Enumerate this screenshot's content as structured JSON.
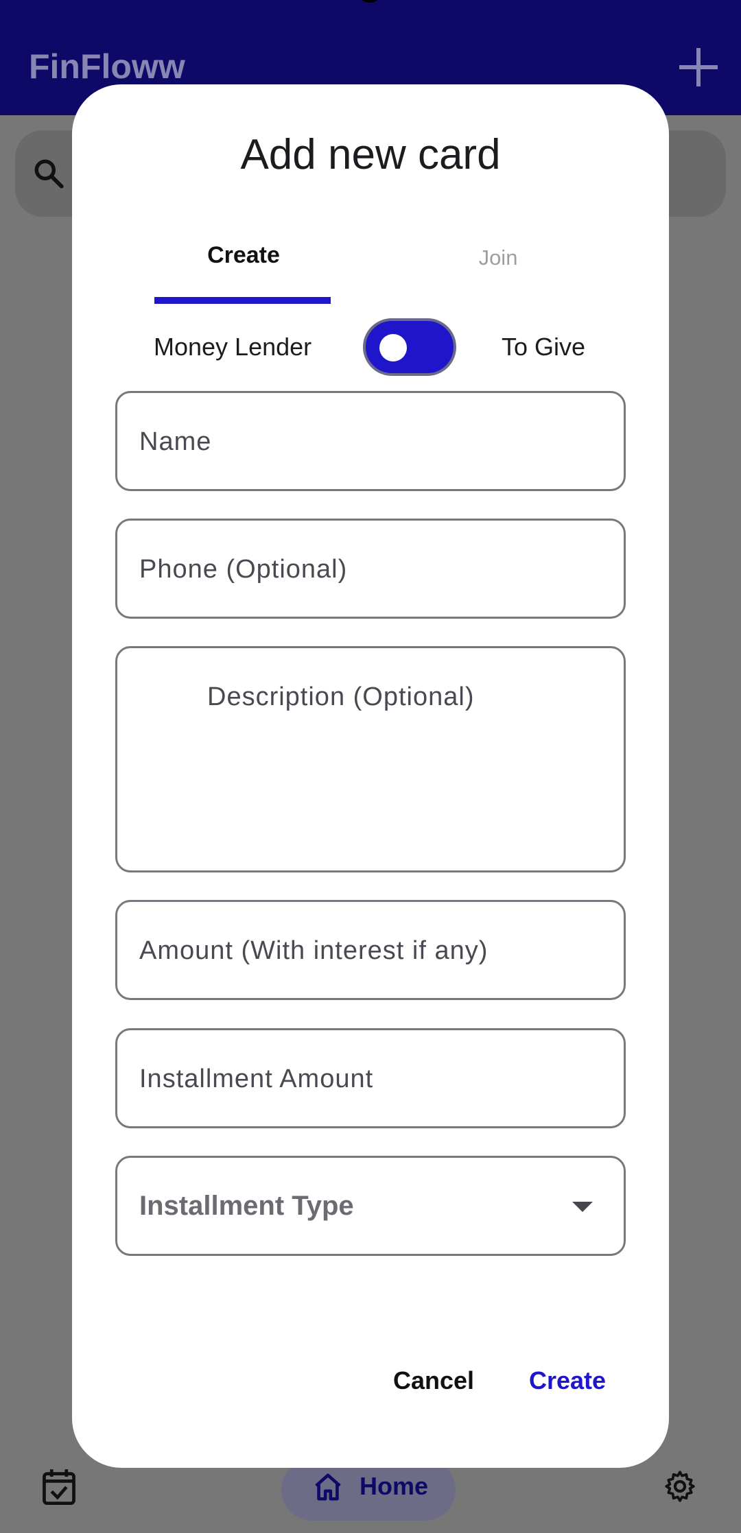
{
  "app": {
    "title": "FinFloww"
  },
  "nav": {
    "home_label": "Home"
  },
  "dialog": {
    "title": "Add new card",
    "tabs": [
      {
        "label": "Create",
        "selected": true
      },
      {
        "label": "Join",
        "selected": false
      }
    ],
    "toggle": {
      "left_label": "Money Lender",
      "right_label": "To Give",
      "on": true
    },
    "fields": {
      "name": "Name",
      "phone": "Phone (Optional)",
      "description": "Description (Optional)",
      "amount": "Amount (With interest if any)",
      "installment_amount": "Installment Amount",
      "installment_type": "Installment Type"
    },
    "actions": {
      "cancel": "Cancel",
      "create": "Create"
    }
  },
  "colors": {
    "primary": "#1f16cc",
    "app_bar": "#0e0866",
    "scrim": "#777777"
  }
}
